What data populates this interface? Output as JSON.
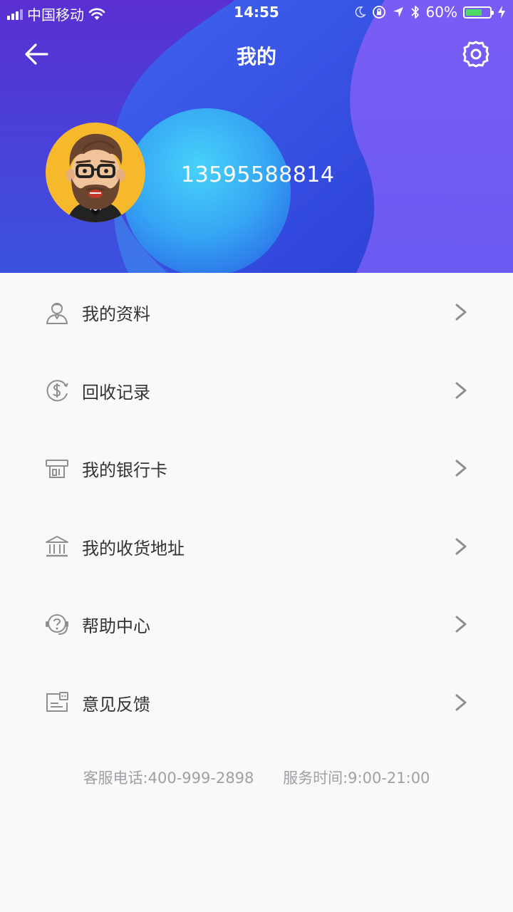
{
  "status_bar": {
    "carrier": "中国移动",
    "time": "14:55",
    "battery_percent": "60%",
    "battery_level": 0.6,
    "icons": [
      "signal-icon",
      "wifi-icon",
      "moon-icon",
      "rotation-lock-icon",
      "location-icon",
      "bluetooth-icon",
      "battery-icon",
      "charging-icon"
    ]
  },
  "navbar": {
    "title": "我的",
    "back_icon": "back-arrow-icon",
    "settings_icon": "gear-icon"
  },
  "profile": {
    "phone": "13595588814",
    "avatar_icon": "bearded-man-avatar"
  },
  "menu": {
    "items": [
      {
        "label": "我的资料",
        "icon": "user-profile-icon"
      },
      {
        "label": "回收记录",
        "icon": "dollar-coin-icon"
      },
      {
        "label": "我的银行卡",
        "icon": "atm-card-icon"
      },
      {
        "label": "我的收货地址",
        "icon": "building-icon"
      },
      {
        "label": "帮助中心",
        "icon": "help-headset-icon"
      },
      {
        "label": "意见反馈",
        "icon": "feedback-icon"
      }
    ],
    "arrow_icon": "chevron-right-icon"
  },
  "footer": {
    "hotline": "客服电话:400-999-2898",
    "hours": "服务时间:9:00-21:00"
  },
  "colors": {
    "header_primary": "#4a4ae6",
    "header_accent": "#3fc6f5",
    "avatar_bg": "#f7b92c",
    "page_bg": "#f9f9fa",
    "text": "#333333",
    "footer_text": "#a0a0a5",
    "icon_gray": "#8e8e93"
  }
}
